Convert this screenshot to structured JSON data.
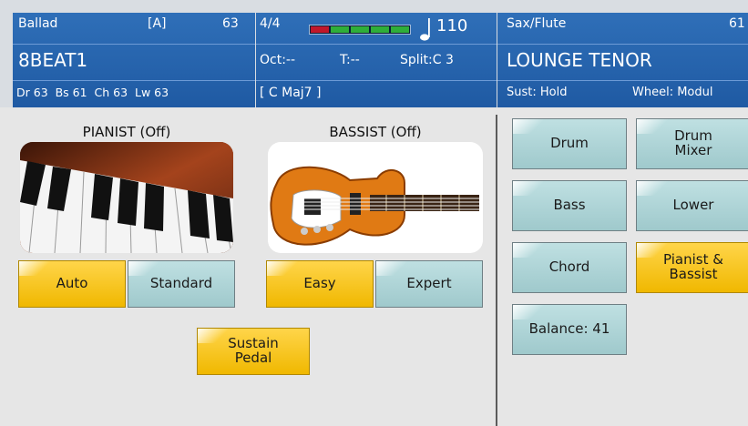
{
  "header": {
    "style_panel": {
      "category": "Ballad",
      "variation": "[A]",
      "tempo_value": "63",
      "style_name": "8BEAT1",
      "volumes": "Dr 63  Bs 61  Ch 63  Lw 63"
    },
    "center_panel": {
      "time_signature": "4/4",
      "tempo": "110",
      "octave": "Oct:--",
      "transpose": "T:--",
      "split": "Split:C 3",
      "chord": "[ C Maj7 ]",
      "meter_colors": [
        "#c0182a",
        "#2fae3a",
        "#2fae3a",
        "#2fae3a",
        "#2fae3a"
      ]
    },
    "sound_panel": {
      "category": "Sax/Flute",
      "number": "61",
      "sound_name": "LOUNGE TENOR",
      "sustain": "Sust: Hold",
      "wheel": "Wheel: Modul"
    }
  },
  "left": {
    "pianist_title": "PIANIST (Off)",
    "bassist_title": "BASSIST (Off)",
    "pianist_buttons": [
      {
        "label": "Auto",
        "active": true
      },
      {
        "label": "Standard",
        "active": false
      }
    ],
    "bassist_buttons": [
      {
        "label": "Easy",
        "active": true
      },
      {
        "label": "Expert",
        "active": false
      }
    ],
    "sustain_pedal": {
      "label": "Sustain Pedal",
      "active": true
    }
  },
  "right": {
    "buttons": [
      {
        "label": "Drum",
        "active": false
      },
      {
        "label": "Drum Mixer",
        "active": false
      },
      {
        "label": "Bass",
        "active": false
      },
      {
        "label": "Lower",
        "active": false
      },
      {
        "label": "Chord",
        "active": false
      },
      {
        "label": "Pianist & Bassist",
        "active": true
      },
      {
        "label": "Balance: 41",
        "active": false
      }
    ]
  },
  "colors": {
    "header_blue": "#2467b0",
    "button_off": "#a9d2d5",
    "button_on": "#f7c21a"
  }
}
